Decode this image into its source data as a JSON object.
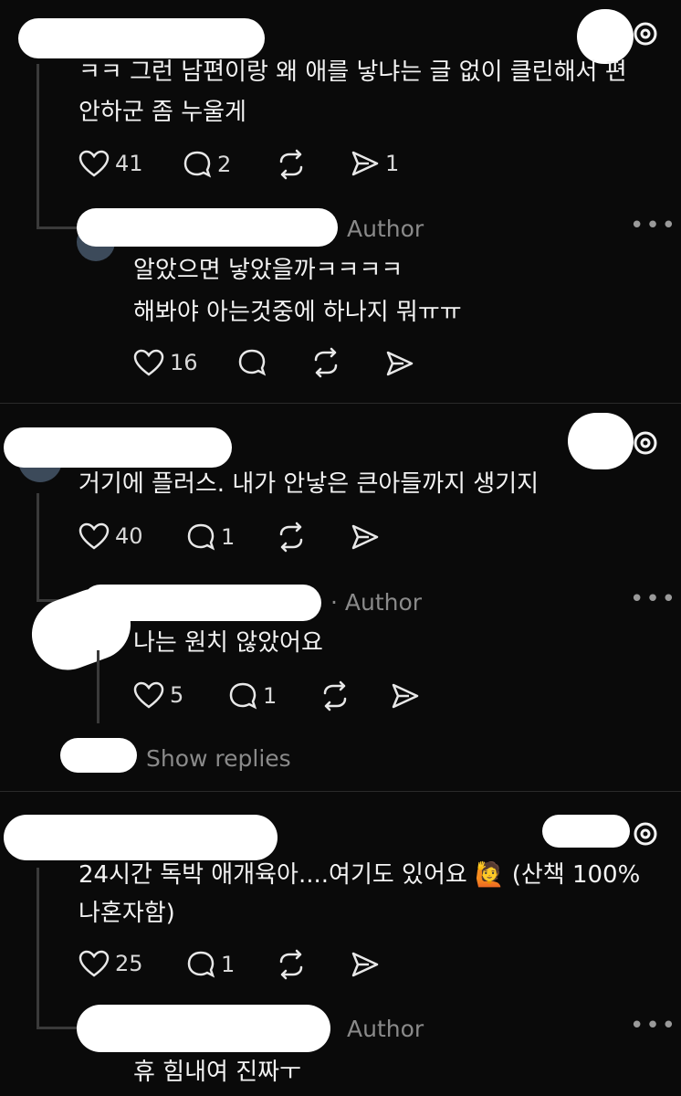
{
  "threads": [
    {
      "comment": {
        "lines": [
          "ㅋㅋ 그런 남편이랑 왜 애를 낳냐는 글 없이 클린해서 편",
          "안하군 좀 누울게"
        ],
        "likes": "41",
        "replies": "2",
        "shares": "1"
      },
      "reply": {
        "author_label": "Author",
        "lines": [
          "알았으면 낳았을까ㅋㅋㅋㅋ",
          "해봐야 아는것중에 하나지 뭐ㅠㅠ"
        ],
        "likes": "16"
      }
    },
    {
      "comment": {
        "lines": [
          "거기에 플러스. 내가 안낳은 큰아들까지 생기지"
        ],
        "likes": "40",
        "replies": "1"
      },
      "reply": {
        "author_label": "· Author",
        "lines": [
          "나는 원치 않았어요"
        ],
        "likes": "5",
        "replies": "1"
      },
      "show_replies": "Show replies"
    },
    {
      "comment": {
        "lines": [
          "24시간 독박 애개육아....여기도 있어요 🙋 (산책 100%",
          "나혼자함)"
        ],
        "likes": "25",
        "replies": "1"
      },
      "reply": {
        "author_label": "Author",
        "lines": [
          "휴 힘내여 진짜ㅜ"
        ]
      }
    }
  ],
  "icons": {
    "heart": "heart-icon",
    "comment": "comment-icon",
    "repost": "repost-icon",
    "share": "share-icon",
    "threads": "threads-logo-icon",
    "more": "more-icon"
  }
}
